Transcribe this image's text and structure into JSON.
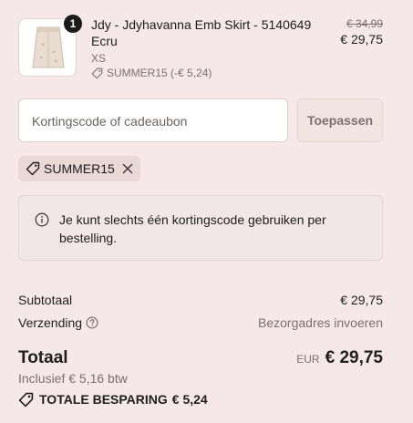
{
  "product": {
    "quantity": "1",
    "title": "Jdy - Jdyhavanna Emb Skirt - 5140649 Ecru",
    "size": "XS",
    "discount_note": "SUMMER15 (-€ 5,24)",
    "price_original": "€ 34,99",
    "price_current": "€ 29,75",
    "thumb_icon": "skirt-image"
  },
  "discount_code": {
    "placeholder": "Kortingscode of cadeaubon",
    "value": "",
    "apply_label": "Toepassen"
  },
  "applied_code": {
    "label": "SUMMER15"
  },
  "notice": {
    "text": "Je kunt slechts één kortingscode gebruiken per bestelling."
  },
  "summary": {
    "subtotal_label": "Subtotaal",
    "subtotal_value": "€ 29,75",
    "shipping_label": "Verzending",
    "shipping_value": "Bezorgadres invoeren",
    "total_label": "Totaal",
    "total_currency": "EUR",
    "total_value": "€ 29,75",
    "tax_note": "Inclusief € 5,16 btw",
    "savings_label": "TOTALE BESPARING",
    "savings_value": "€ 5,24"
  },
  "colors": {
    "background": "#f6e8e8",
    "text": "#1d1d1d",
    "muted": "#7b6f6f",
    "chip": "#ead8d8"
  }
}
